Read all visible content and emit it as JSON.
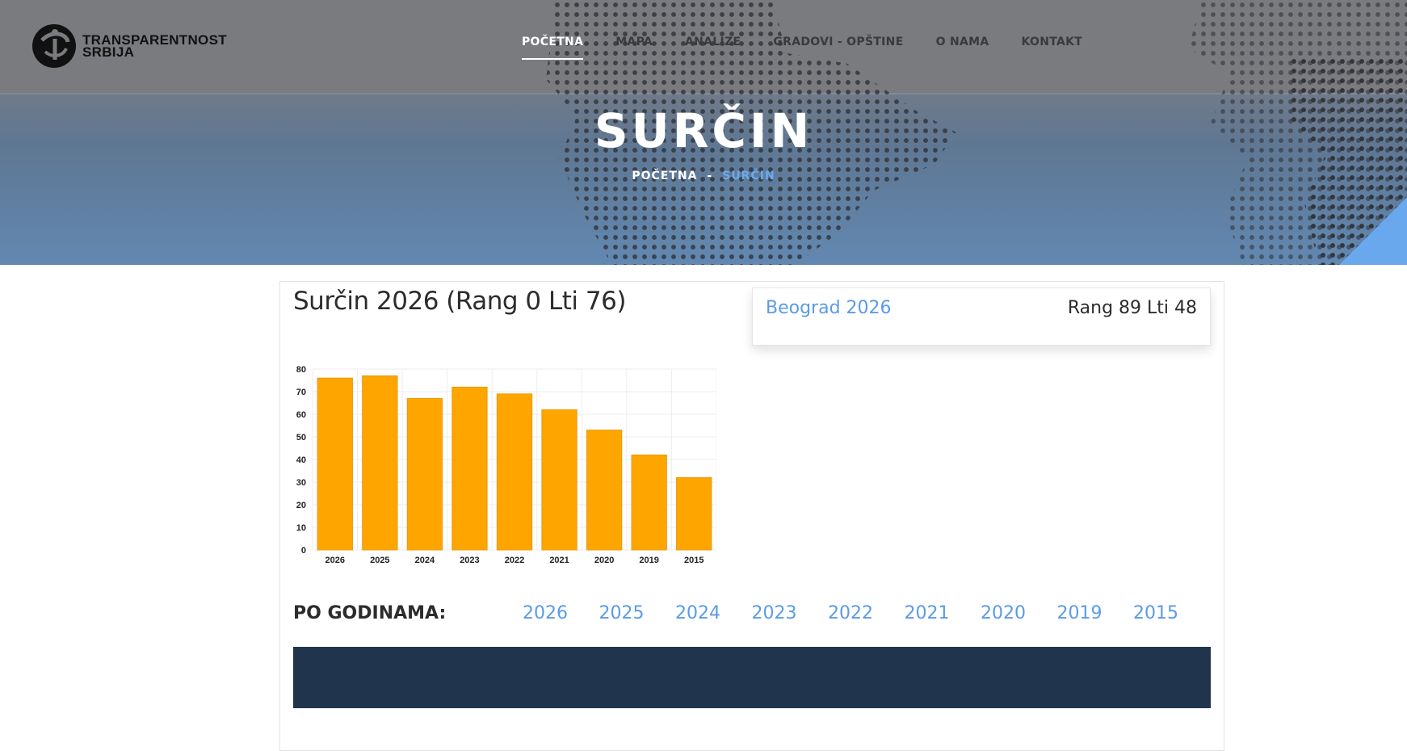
{
  "brand": {
    "line1": "TRANSPARENTNOST",
    "line2": "SRBIJA",
    "logo_icon": "ti-logo-icon"
  },
  "nav": {
    "items": [
      {
        "label": "POČETNA",
        "active": true
      },
      {
        "label": "MAPA"
      },
      {
        "label": "ANALIZE"
      },
      {
        "label": "GRADOVI - OPŠTINE"
      },
      {
        "label": "O NAMA"
      },
      {
        "label": "KONTAKT"
      }
    ]
  },
  "hero": {
    "title": "SURČIN",
    "breadcrumb": {
      "home": "POČETNA",
      "separator": "-",
      "current": "SURČIN"
    }
  },
  "card": {
    "title": "Surčin 2026 (Rang 0 Lti 76)",
    "region": {
      "name": "Beograd 2026",
      "rank": "Rang 89 Lti 48"
    }
  },
  "by_years": {
    "label": "PO GODINAMA:",
    "years": [
      "2026",
      "2025",
      "2024",
      "2023",
      "2022",
      "2021",
      "2020",
      "2019",
      "2015"
    ]
  },
  "colors": {
    "bar": "#ffa500",
    "bar_border": "#e89a12",
    "link": "#5b9be6",
    "band": "#20344d"
  },
  "chart_data": {
    "type": "bar",
    "categories": [
      "2026",
      "2025",
      "2024",
      "2023",
      "2022",
      "2021",
      "2020",
      "2019",
      "2015"
    ],
    "values": [
      76,
      77,
      67,
      72,
      69,
      62,
      53,
      42,
      32
    ],
    "yticks": [
      "0",
      "10",
      "20",
      "30",
      "40",
      "50",
      "60",
      "70",
      "80"
    ],
    "ylim": [
      0,
      80
    ],
    "grid": true
  }
}
